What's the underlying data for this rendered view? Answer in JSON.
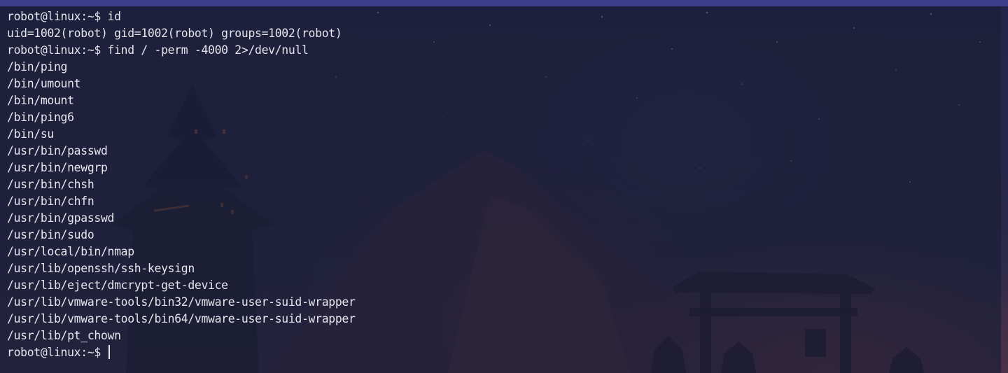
{
  "terminal": {
    "lines": [
      "robot@linux:~$ id",
      "uid=1002(robot) gid=1002(robot) groups=1002(robot)",
      "robot@linux:~$ find / -perm -4000 2>/dev/null",
      "/bin/ping",
      "/bin/umount",
      "/bin/mount",
      "/bin/ping6",
      "/bin/su",
      "/usr/bin/passwd",
      "/usr/bin/newgrp",
      "/usr/bin/chsh",
      "/usr/bin/chfn",
      "/usr/bin/gpasswd",
      "/usr/bin/sudo",
      "/usr/local/bin/nmap",
      "/usr/lib/openssh/ssh-keysign",
      "/usr/lib/eject/dmcrypt-get-device",
      "/usr/lib/vmware-tools/bin32/vmware-user-suid-wrapper",
      "/usr/lib/vmware-tools/bin64/vmware-user-suid-wrapper",
      "/usr/lib/pt_chown"
    ],
    "prompt": "robot@linux:~$ "
  },
  "colors": {
    "text": "#e6e6ee",
    "terminal_bg": "#1c1e38",
    "topbar": "#3b3f8c"
  }
}
